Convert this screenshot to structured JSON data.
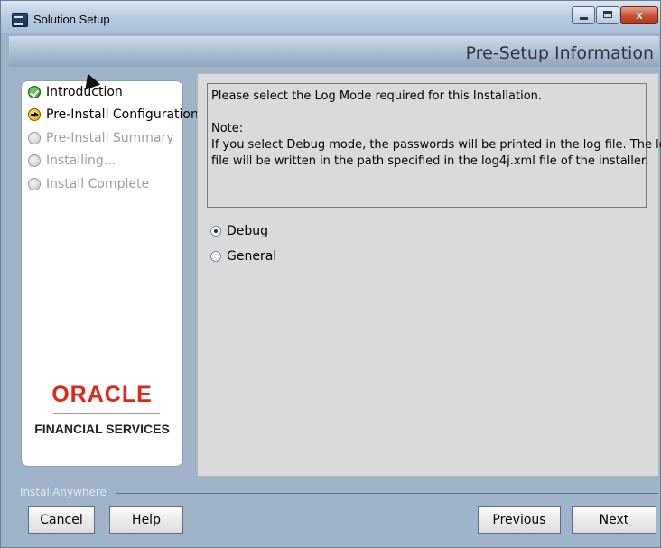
{
  "window": {
    "title": "Solution Setup",
    "close_label": "x"
  },
  "header": {
    "title": "Pre-Setup Information"
  },
  "steps": [
    {
      "label": "Introduction",
      "state": "done"
    },
    {
      "label": "Pre-Install Configuration",
      "state": "current"
    },
    {
      "label": "Pre-Install Summary",
      "state": "pending"
    },
    {
      "label": "Installing...",
      "state": "pending"
    },
    {
      "label": "Install Complete",
      "state": "pending"
    }
  ],
  "logo": {
    "brand": "ORACLE",
    "tagline": "FINANCIAL SERVICES"
  },
  "info": {
    "line1": "Please select the Log Mode required for this Installation.",
    "note_label": "Note:",
    "note_line1": "If you select Debug mode, the passwords will be printed in the log file. The log",
    "note_line2": "file will be written in the path specified in the log4j.xml file of the installer."
  },
  "log_mode": {
    "options": [
      {
        "label": "Debug",
        "selected": true
      },
      {
        "label": "General",
        "selected": false
      }
    ]
  },
  "footer": {
    "vendor": "InstallAnywhere",
    "cancel": "Cancel",
    "help_first": "H",
    "help_rest": "elp",
    "previous_first": "P",
    "previous_rest": "revious",
    "next_first": "N",
    "next_rest": "ext"
  }
}
